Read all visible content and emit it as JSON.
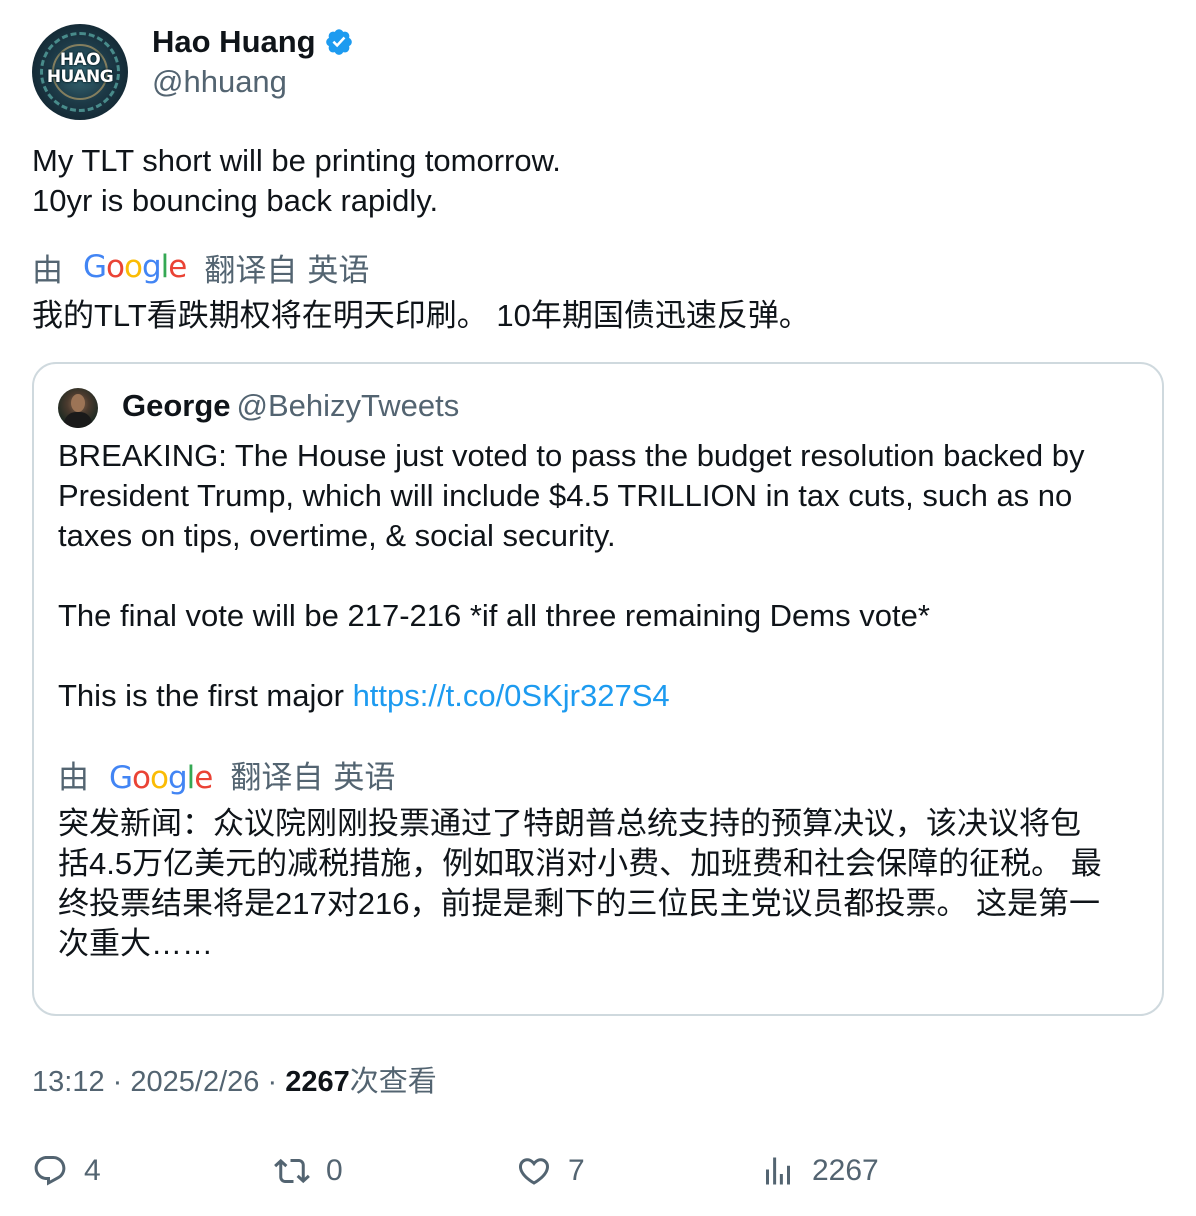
{
  "author": {
    "display_name": "Hao Huang",
    "handle": "@hhuang",
    "verified": true,
    "avatar_text": [
      "HAO",
      "HUANG"
    ]
  },
  "tweet": {
    "lines": [
      "My TLT short will be printing tomorrow.",
      "10yr is bouncing back rapidly."
    ],
    "translated_by": {
      "prefix": "由",
      "provider": "Google",
      "from": "翻译自",
      "language": "英语"
    },
    "translation": "我的TLT看跌期权将在明天印刷。 10年期国债迅速反弹。"
  },
  "quote": {
    "display_name": "George",
    "handle": "@BehizyTweets",
    "paragraphs": [
      "BREAKING: The House just voted to pass the budget resolution backed by President Trump, which will include $4.5 TRILLION in tax cuts, such as no taxes on tips, overtime, & social security.",
      "The final vote will be 217-216 *if all three remaining Dems vote*"
    ],
    "last_paragraph_prefix": "This is the first major ",
    "link": "https://t.co/0SKjr327S4",
    "translated_by": {
      "prefix": "由",
      "provider": "Google",
      "from": "翻译自",
      "language": "英语"
    },
    "translation_lines": [
      "突发新闻：众议院刚刚投票通过了特朗普总统支持的预算决议，该决议将包",
      "括4.5万亿美元的减税措施，例如取消对小费、加班费和社会保障的征税。 最",
      "终投票结果将是217对216，前提是剩下的三位民主党议员都投票。 这是第一",
      "次重大……"
    ]
  },
  "meta": {
    "time": "13:12",
    "sep1": "·",
    "date": "2025/2/26",
    "sep2": "·",
    "views_count": "2267",
    "views_label": "次查看"
  },
  "actions": {
    "replies": "4",
    "retweets": "0",
    "likes": "7",
    "views": "2267"
  },
  "colors": {
    "text": "#0f1419",
    "secondary": "#536471",
    "link": "#1d9bf0",
    "border": "#cfd9de",
    "verified": "#1d9bf0"
  }
}
